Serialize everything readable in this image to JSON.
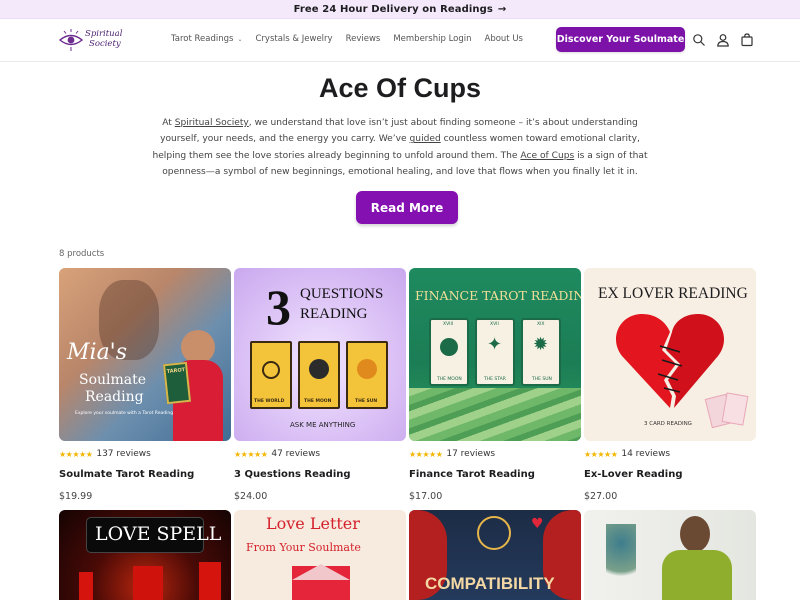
{
  "announcement": {
    "text": "Free 24 Hour Delivery on Readings",
    "arrow": "→"
  },
  "brand": {
    "logo_line1": "Spiritual",
    "logo_line2": "Society"
  },
  "nav": {
    "items": [
      {
        "label": "Tarot Readings",
        "has_dropdown": true,
        "chevron": "⌄"
      },
      {
        "label": "Crystals & Jewelry"
      },
      {
        "label": "Reviews"
      },
      {
        "label": "Membership Login"
      },
      {
        "label": "About Us"
      }
    ],
    "cta": "Discover Your Soulmate"
  },
  "icons": {
    "search": "search-icon",
    "account": "account-icon",
    "cart": "cart-icon"
  },
  "colors": {
    "accent": "#8410b2",
    "announcement_bg": "#f4e8fb",
    "stars": "#f2b600"
  },
  "collection": {
    "title": "Ace Of Cups",
    "intro": {
      "p1": "At ",
      "link1": "Spiritual Society",
      "p2": ", we understand that love isn’t just about finding someone – it’s about understanding yourself, your needs, and the energy you carry. We’ve ",
      "link2": "guided",
      "p3": " countless women toward emotional clarity, helping them see the love stories already beginning to unfold around them. The ",
      "link3": "Ace of Cups",
      "p4": " is a sign of that openness—a symbol of new beginnings, emotional healing, and love that flows when you finally let it in."
    },
    "read_more": "Read More",
    "product_count": "8 products"
  },
  "products": [
    {
      "name": "Soulmate Tarot Reading",
      "price": "$19.99",
      "stars": "★★★★★",
      "reviews": "137 reviews",
      "image": {
        "title_a": "Mia's",
        "title_b": "Soulmate",
        "title_c": "Reading",
        "caption": "Explore your soulmate with a Tarot Reading",
        "card_label": "TAROT"
      }
    },
    {
      "name": "3 Questions Reading",
      "price": "$24.00",
      "stars": "★★★★★",
      "reviews": "47 reviews",
      "image": {
        "number": "3",
        "title_a": "QUESTIONS",
        "title_b": "READING",
        "card1": "THE WORLD",
        "card2": "THE MOON",
        "card3": "THE SUN",
        "caption": "ASK ME ANYTHING"
      }
    },
    {
      "name": "Finance Tarot Reading",
      "price": "$17.00",
      "stars": "★★★★★",
      "reviews": "17 reviews",
      "image": {
        "title": "FINANCE TAROT READING",
        "card1": "THE MOON",
        "card2": "THE STAR",
        "card3": "THE SUN",
        "num1": "XVIII",
        "num2": "XVII",
        "num3": "XIX"
      }
    },
    {
      "name": "Ex-Lover Reading",
      "price": "$27.00",
      "stars": "★★★★★",
      "reviews": "14 reviews",
      "image": {
        "title": "EX LOVER READING",
        "caption": "3 CARD READING"
      }
    },
    {
      "name": "",
      "price": "",
      "stars": "",
      "reviews": "",
      "image": {
        "title": "LOVE SPELL"
      }
    },
    {
      "name": "",
      "price": "",
      "stars": "",
      "reviews": "",
      "image": {
        "title_a": "Love Letter",
        "title_b": "From Your Soulmate"
      }
    },
    {
      "name": "",
      "price": "",
      "stars": "",
      "reviews": "",
      "image": {
        "title": "COMPATIBILITY"
      }
    },
    {
      "name": "",
      "price": "",
      "stars": "",
      "reviews": "",
      "image": {}
    }
  ]
}
